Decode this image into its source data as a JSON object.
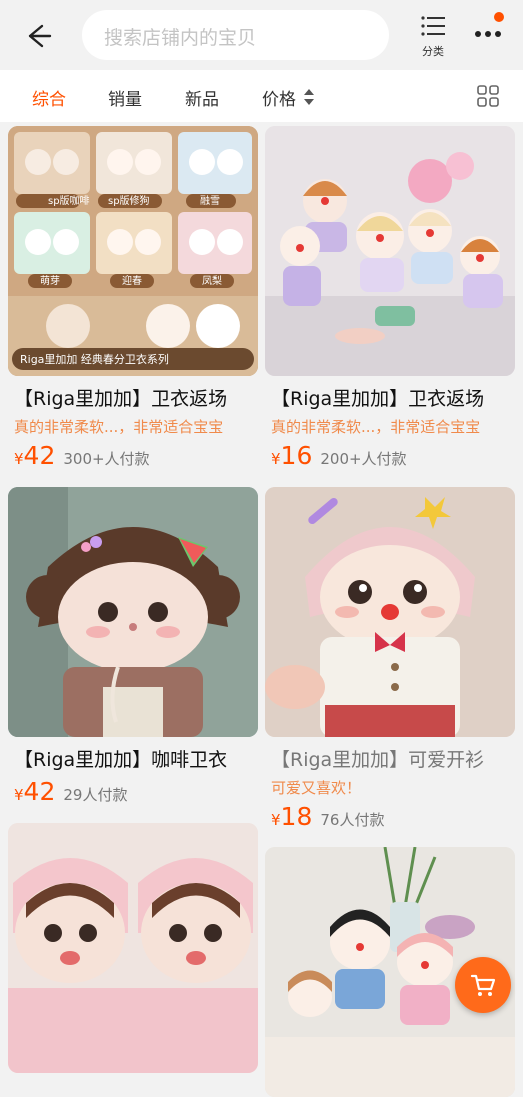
{
  "header": {
    "search_placeholder": "搜索店铺内的宝贝",
    "category_label": "分类"
  },
  "tabs": [
    {
      "label": "综合",
      "active": true
    },
    {
      "label": "销量",
      "active": false
    },
    {
      "label": "新品",
      "active": false
    },
    {
      "label": "价格",
      "active": false
    }
  ],
  "products": [
    {
      "title": "【Riga里加加】卫衣返场",
      "desc": "真的非常柔软...，非常适合宝宝",
      "currency": "¥",
      "price": "42",
      "sold": "300+人付款",
      "image_texts": [
        "sp版咖啡",
        "sp版修狗",
        "融雪",
        "萌芽",
        "迎春",
        "凤梨",
        "Riga里加加 经典春分卫衣系列"
      ]
    },
    {
      "title": "【Riga里加加】卫衣返场",
      "desc": "真的非常柔软...，非常适合宝宝",
      "currency": "¥",
      "price": "16",
      "sold": "200+人付款"
    },
    {
      "title": "【Riga里加加】咖啡卫衣",
      "desc": "",
      "currency": "¥",
      "price": "42",
      "sold": "29人付款"
    },
    {
      "title": "【Riga里加加】可爱开衫",
      "desc": "可爱又喜欢！",
      "currency": "¥",
      "price": "18",
      "sold": "76人付款"
    },
    {
      "title": "",
      "desc": "",
      "currency": "",
      "price": "",
      "sold": ""
    },
    {
      "title": "",
      "desc": "",
      "currency": "",
      "price": "",
      "sold": ""
    }
  ],
  "colors": {
    "accent": "#ff5000",
    "desc": "#f08a4b"
  },
  "icons": [
    "back-arrow-icon",
    "category-list-icon",
    "more-dots-icon",
    "sort-arrows-icon",
    "grid-layout-icon",
    "cart-icon"
  ]
}
